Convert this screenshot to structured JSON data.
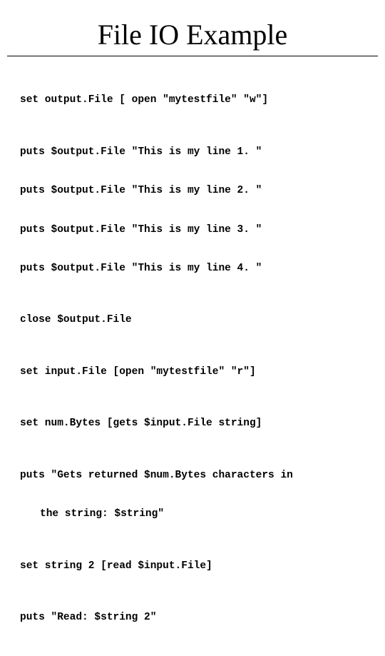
{
  "title": "File IO Example",
  "code": {
    "l01": "set output.File [ open \"mytestfile\" \"w\"]",
    "l02": "puts $output.File \"This is my line 1. \"",
    "l03": "puts $output.File \"This is my line 2. \"",
    "l04": "puts $output.File \"This is my line 3. \"",
    "l05": "puts $output.File \"This is my line 4. \"",
    "l06": "close $output.File",
    "l07": "set input.File [open \"mytestfile\" \"r\"]",
    "l08": "set num.Bytes [gets $input.File string]",
    "l09a": "puts \"Gets returned $num.Bytes characters in",
    "l09b": "the string: $string\"",
    "l10": "set string 2 [read $input.File]",
    "l11": "puts \"Read: $string 2\""
  }
}
